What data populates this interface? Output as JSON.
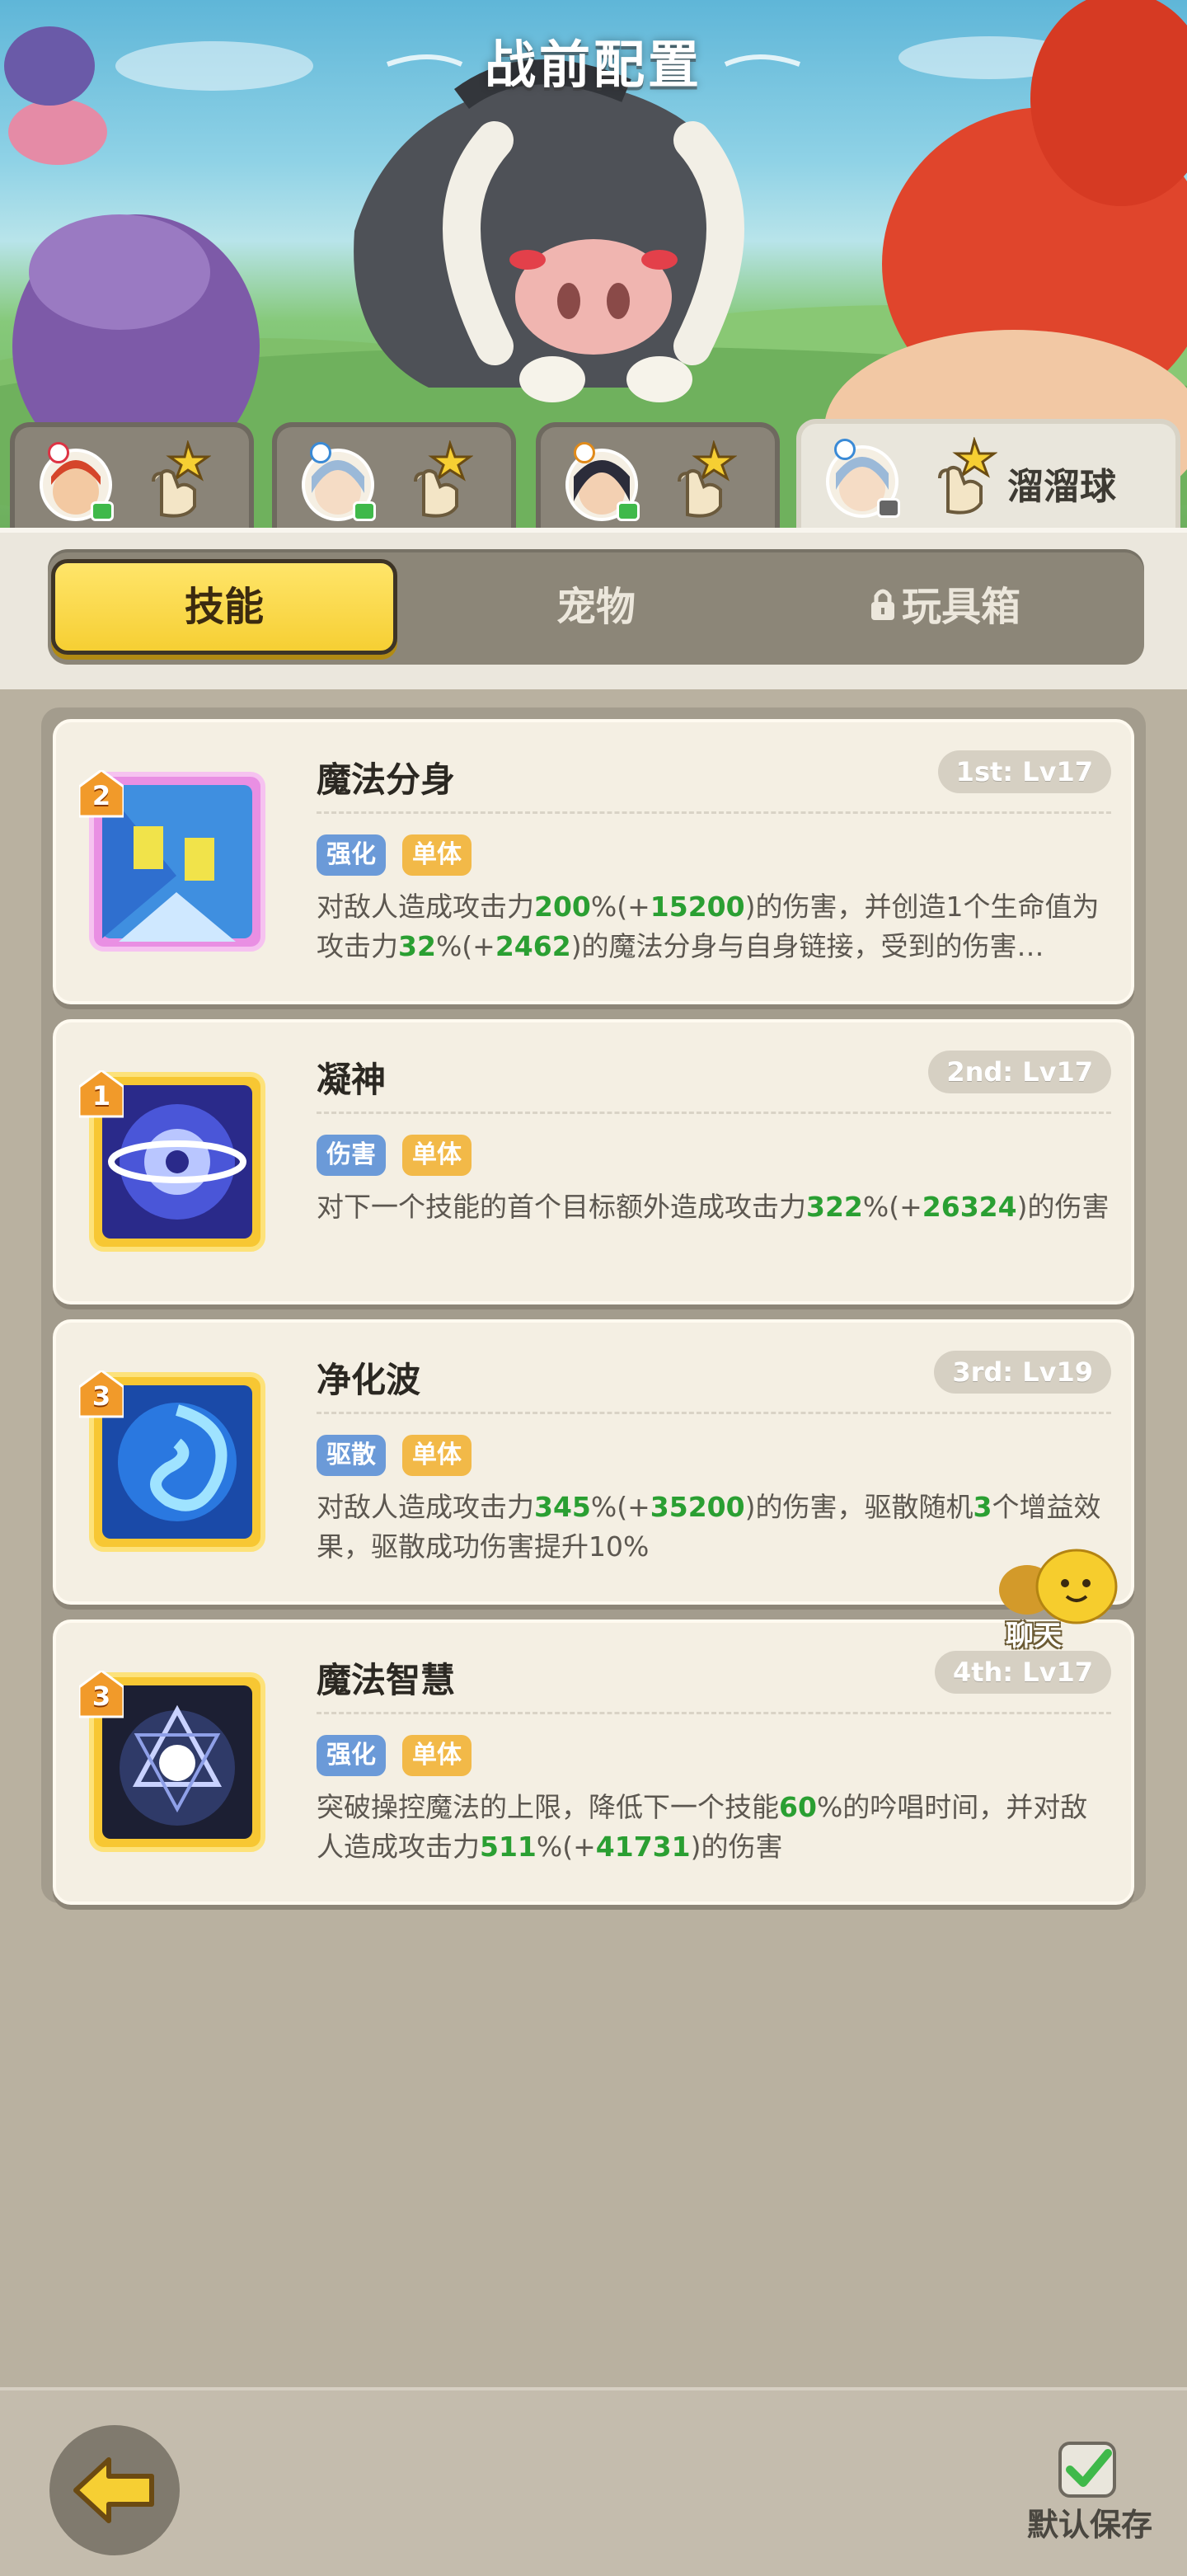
{
  "header": {
    "title": "战前配置"
  },
  "hero_tabs": [
    {
      "label": "",
      "active": false
    },
    {
      "label": "",
      "active": false
    },
    {
      "label": "",
      "active": false
    },
    {
      "label": "溜溜球",
      "active": true
    }
  ],
  "segments": [
    {
      "label": "技能",
      "active": true
    },
    {
      "label": "宠物",
      "active": false
    },
    {
      "label": "玩具箱",
      "locked": true
    }
  ],
  "skills": [
    {
      "rank": "2",
      "name": "魔法分身",
      "level": "1st: Lv17",
      "tags": [
        "强化",
        "单体"
      ],
      "desc": [
        {
          "t": "对敌人造成攻击力"
        },
        {
          "t": "200",
          "g": true
        },
        {
          "t": "%(+"
        },
        {
          "t": "15200",
          "g": true
        },
        {
          "t": ")的伤害，并创造1个生命值为攻击力"
        },
        {
          "t": "32",
          "g": true
        },
        {
          "t": "%(+"
        },
        {
          "t": "2462",
          "g": true
        },
        {
          "t": ")的魔法分身与自身链接，受到的伤害…"
        }
      ]
    },
    {
      "rank": "1",
      "name": "凝神",
      "level": "2nd: Lv17",
      "tags": [
        "伤害",
        "单体"
      ],
      "desc": [
        {
          "t": "对下一个技能的首个目标额外造成攻击力"
        },
        {
          "t": "322",
          "g": true
        },
        {
          "t": "%(+"
        },
        {
          "t": "26324",
          "g": true
        },
        {
          "t": ")的伤害"
        }
      ]
    },
    {
      "rank": "3",
      "name": "净化波",
      "level": "3rd: Lv19",
      "tags": [
        "驱散",
        "单体"
      ],
      "desc": [
        {
          "t": "对敌人造成攻击力"
        },
        {
          "t": "345",
          "g": true
        },
        {
          "t": "%(+"
        },
        {
          "t": "35200",
          "g": true
        },
        {
          "t": ")的伤害，驱散随机"
        },
        {
          "t": "3",
          "g": true
        },
        {
          "t": "个增益效果，驱散成功伤害提升10%"
        }
      ]
    },
    {
      "rank": "3",
      "name": "魔法智慧",
      "level": "4th: Lv17",
      "tags": [
        "强化",
        "单体"
      ],
      "desc": [
        {
          "t": "突破操控魔法的上限，降低下一个技能"
        },
        {
          "t": "60",
          "g": true
        },
        {
          "t": "%的吟唱时间，并对敌人造成攻击力"
        },
        {
          "t": "511",
          "g": true
        },
        {
          "t": "%(+"
        },
        {
          "t": "41731",
          "g": true
        },
        {
          "t": ")的伤害"
        }
      ]
    }
  ],
  "chat": {
    "label": "聊天"
  },
  "footer": {
    "save_label": "默认保存",
    "save_checked": true
  },
  "colors": {
    "accent_yellow": "#f6cf33",
    "highlight_green": "#2a9f32",
    "tag_blue": "#6b9ad8",
    "tag_orange": "#f2b948"
  }
}
